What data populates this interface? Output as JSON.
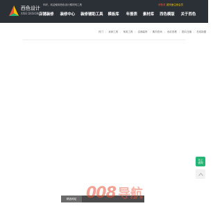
{
  "header": {
    "logo": {
      "name": "西色设计",
      "sub": "XISE DESIGN"
    },
    "tagline": "你好，欢迎使用西色设计素材网工具",
    "links": {
      "register": "请登录",
      "login": "或快速注册会员"
    },
    "nav": [
      "店铺装修",
      "装修中心",
      "装修辅助工具",
      "模板库",
      "年报表",
      "素材库",
      "西色模版",
      "关于西色"
    ]
  },
  "breadcrumbs": [
    "热门",
    "卖家工具",
    "常用工具",
    "店铺装修",
    "素材查询",
    "色彩查看",
    "图片压缩",
    "在线制图"
  ],
  "side_button": {
    "line1": "马上",
    "line2": "咨询"
  },
  "bottom_bar": {
    "items": [
      "精选网站",
      "",
      "",
      ""
    ]
  },
  "watermark": {
    "number": "008",
    "word": "导航"
  },
  "colors": {
    "topbar": "#2b2f36",
    "accent_red": "#e8543a",
    "accent_yellow": "#f2c200",
    "side_button_green": "#22b573"
  }
}
